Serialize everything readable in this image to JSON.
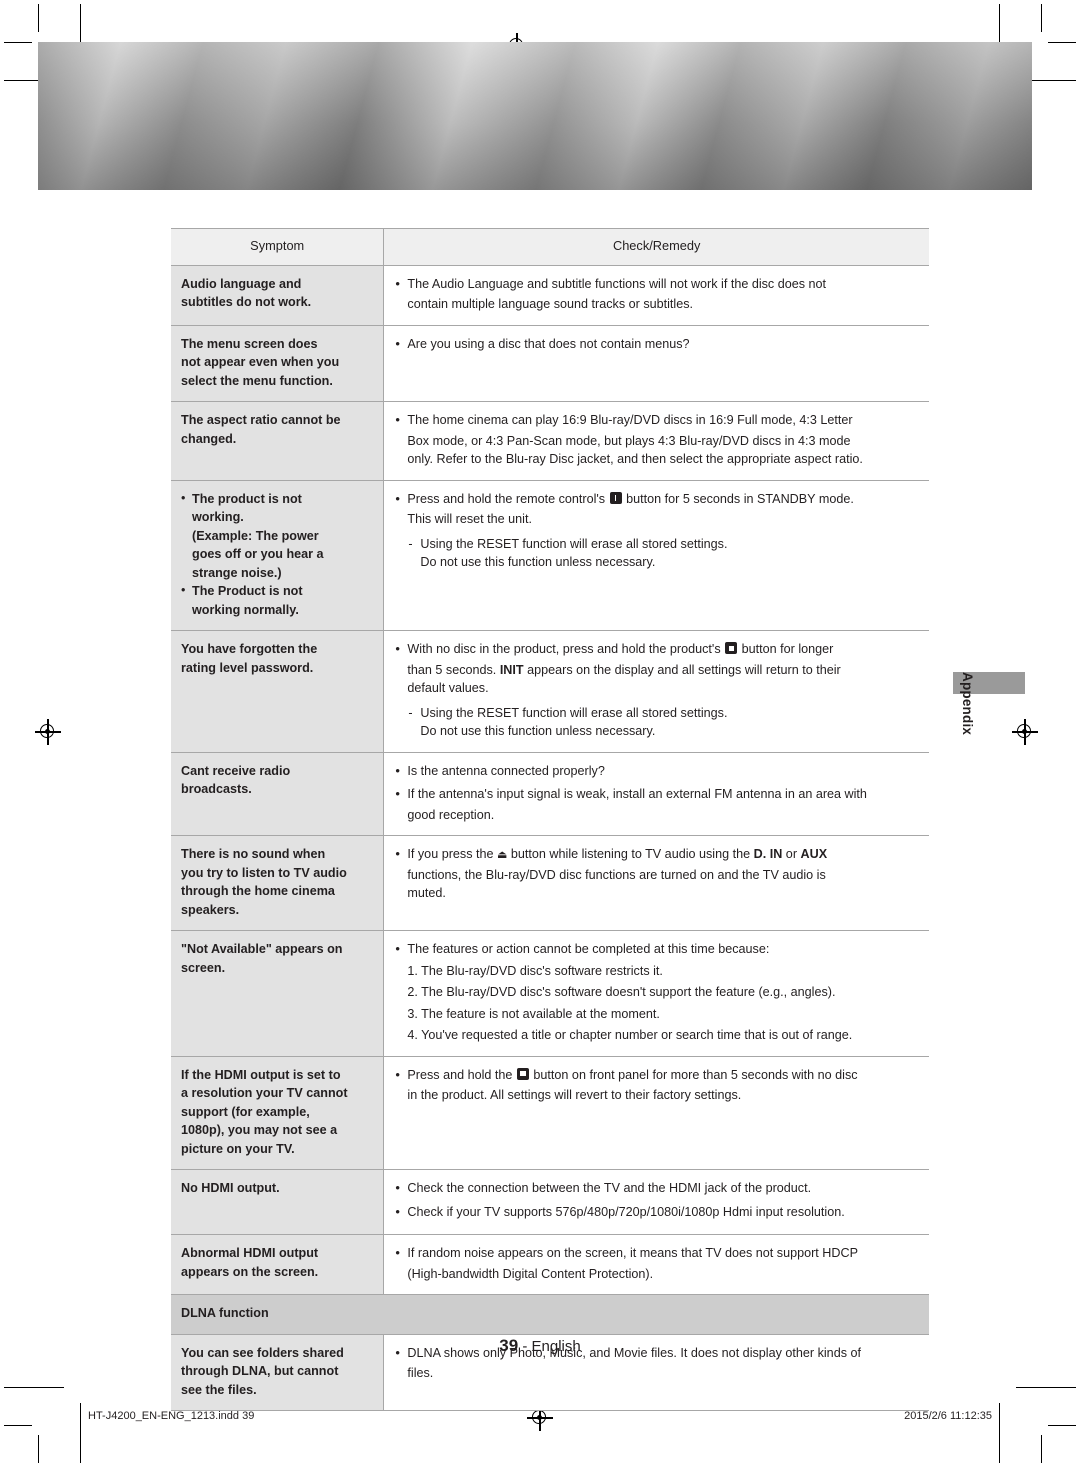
{
  "page": {
    "number": "39",
    "language_label": "- English",
    "side_tab_label": "Appendix"
  },
  "footer": {
    "filename": "HT-J4200_EN-ENG_1213.indd   39",
    "timestamp": "2015/2/6   11:12:35"
  },
  "table": {
    "headers": {
      "symptom": "Symptom",
      "remedy": "Check/Remedy"
    },
    "rows": [
      {
        "symptom_lines": [
          "Audio language and",
          "subtitles do not work."
        ],
        "remedy_blocks": [
          {
            "type": "bullet",
            "lines": [
              "The Audio Language and subtitle functions will not work if the disc does not",
              "contain multiple language sound tracks or subtitles."
            ]
          }
        ]
      },
      {
        "symptom_lines": [
          "The menu screen does",
          "not appear even when you",
          "select the menu function."
        ],
        "remedy_blocks": [
          {
            "type": "bullet",
            "lines": [
              "Are you using a disc that does not contain menus?"
            ]
          }
        ]
      },
      {
        "symptom_lines": [
          "The aspect ratio cannot be",
          "changed."
        ],
        "remedy_blocks": [
          {
            "type": "bullet",
            "lines": [
              "The home cinema can play 16:9 Blu-ray/DVD discs in 16:9 Full mode, 4:3 Letter",
              "Box mode, or 4:3 Pan-Scan mode, but plays 4:3 Blu-ray/DVD discs in 4:3 mode",
              "only. Refer to the Blu-ray Disc jacket, and then select the appropriate aspect ratio."
            ]
          }
        ]
      },
      {
        "symptom_lines": [
          "• The product is not",
          "working.",
          "(Example: The power",
          "goes off or you hear a",
          "strange noise.)",
          "• The Product is not",
          "working normally."
        ],
        "remedy_blocks": [
          {
            "type": "bullet-glyph",
            "pre": "Press and hold the remote control's ",
            "glyph": "power-standby-button",
            "post": " button for 5 seconds in STANDBY mode.",
            "lines2": [
              "This will reset the unit."
            ]
          },
          {
            "type": "dash",
            "lines": [
              "Using the RESET function will erase all stored settings.",
              "Do not use this function unless necessary."
            ]
          }
        ]
      },
      {
        "symptom_lines": [
          "You have forgotten the",
          "rating level password."
        ],
        "remedy_blocks": [
          {
            "type": "bullet-glyph",
            "pre": "With no disc in the product, press and hold the product's ",
            "glyph": "stop-button",
            "post": " button for longer",
            "lines2": [
              "than 5 seconds. INIT appears on the display and all settings will return to their",
              "default values."
            ]
          },
          {
            "type": "dash",
            "lines": [
              "Using the RESET function will erase all stored settings.",
              "Do not use this function unless necessary."
            ]
          }
        ]
      },
      {
        "symptom_lines": [
          "Cant receive radio",
          "broadcasts."
        ],
        "remedy_blocks": [
          {
            "type": "bullet",
            "lines": [
              "Is the antenna connected properly?"
            ]
          },
          {
            "type": "bullet",
            "lines": [
              "If the antenna's input signal is weak, install an external FM antenna in an area with",
              "good reception."
            ]
          }
        ]
      },
      {
        "symptom_lines": [
          "There is no sound when",
          "you try to listen to TV audio",
          "through the home cinema",
          "speakers."
        ],
        "remedy_blocks": [
          {
            "type": "bullet-eject",
            "pre": "If you press the ",
            "glyph": "eject-button",
            "post": " button while listening to TV audio using the D. IN or AUX",
            "lines2": [
              "functions, the Blu-ray/DVD disc functions are turned on and the TV audio is",
              "muted."
            ]
          }
        ]
      },
      {
        "symptom_lines": [
          "\"Not Available\" appears on",
          "screen."
        ],
        "remedy_blocks": [
          {
            "type": "bullet",
            "lines": [
              "The features or action cannot be completed at this time because:"
            ]
          },
          {
            "type": "numbered",
            "lines": [
              "1. The Blu-ray/DVD disc's software restricts it.",
              "2. The Blu-ray/DVD disc's software doesn't support the feature (e.g., angles).",
              "3. The feature is not available at the moment.",
              "4. You've requested a title or chapter number or search time that is out of range."
            ]
          }
        ]
      },
      {
        "symptom_lines": [
          "If the HDMI output is set to",
          "a resolution your TV cannot",
          "support (for example,",
          "1080p), you may not see a",
          "picture on your TV."
        ],
        "remedy_blocks": [
          {
            "type": "bullet-glyph",
            "pre": "Press and hold the ",
            "glyph": "stop-button",
            "post": " button on front panel for more than 5 seconds with no disc",
            "lines2": [
              "in the product. All settings will revert to their factory settings."
            ]
          }
        ]
      },
      {
        "symptom_lines": [
          "No HDMI output."
        ],
        "remedy_blocks": [
          {
            "type": "bullet",
            "lines": [
              "Check the connection between the TV and the HDMI jack of the product."
            ]
          },
          {
            "type": "bullet",
            "lines": [
              "Check if your TV supports 576p/480p/720p/1080i/1080p Hdmi input resolution."
            ]
          }
        ]
      },
      {
        "symptom_lines": [
          "Abnormal HDMI output",
          "appears on the screen."
        ],
        "remedy_blocks": [
          {
            "type": "bullet",
            "lines": [
              "If random noise appears on the screen, it means that TV does not support HDCP",
              "(High-bandwidth Digital Content Protection)."
            ]
          }
        ]
      }
    ],
    "section_label": "DLNA function",
    "rows_after_section": [
      {
        "symptom_lines": [
          "You can see folders shared",
          "through DLNA, but cannot",
          "see the files."
        ],
        "remedy_blocks": [
          {
            "type": "bullet",
            "lines": [
              "DLNA shows only Photo, Music, and Movie files. It does not display other kinds of",
              "files."
            ]
          }
        ]
      }
    ]
  }
}
